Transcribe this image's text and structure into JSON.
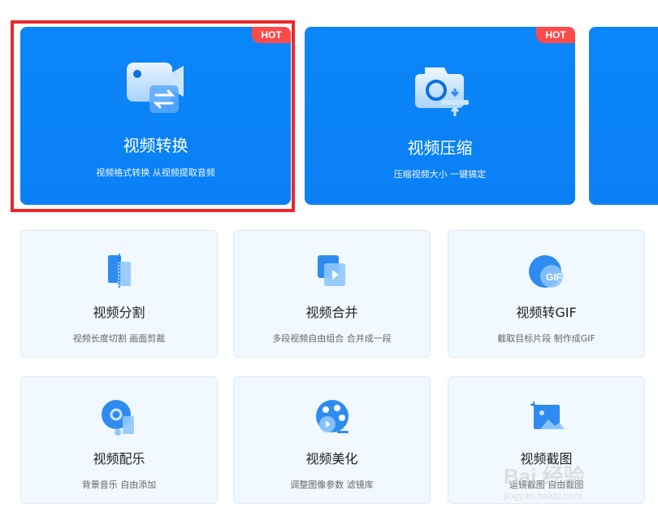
{
  "featured": [
    {
      "title": "视频转换",
      "subtitle": "视频格式转换 从视频提取音频",
      "badge": "HOT",
      "icon": "video-convert-icon"
    },
    {
      "title": "视频压缩",
      "subtitle": "压缩视频大小 一键搞定",
      "badge": "HOT",
      "icon": "video-compress-icon"
    }
  ],
  "tools": [
    {
      "title": "视频分割",
      "subtitle": "视频长度切割 画面剪裁",
      "icon": "video-split-icon"
    },
    {
      "title": "视频合并",
      "subtitle": "多段视频自由组合 合并成一段",
      "icon": "video-merge-icon"
    },
    {
      "title": "视频转GIF",
      "subtitle": "截取目标片段 制作成GIF",
      "icon": "gif-icon",
      "icon_text": "GIF"
    },
    {
      "title": "视频配乐",
      "subtitle": "背景音乐 自由添加",
      "icon": "music-icon"
    },
    {
      "title": "视频美化",
      "subtitle": "调整图像参数 滤镜库",
      "icon": "palette-icon"
    },
    {
      "title": "视频截图",
      "subtitle": "运镜截图 自由截图",
      "icon": "screenshot-icon"
    }
  ],
  "watermark": {
    "brand": "Bai 经验",
    "url": "jingyan.baidu.com"
  },
  "colors": {
    "card_blue": "#0a84f7",
    "hot_red": "#ff4a4a",
    "highlight_red": "#e8282c",
    "tool_bg": "#f2f8ff"
  }
}
